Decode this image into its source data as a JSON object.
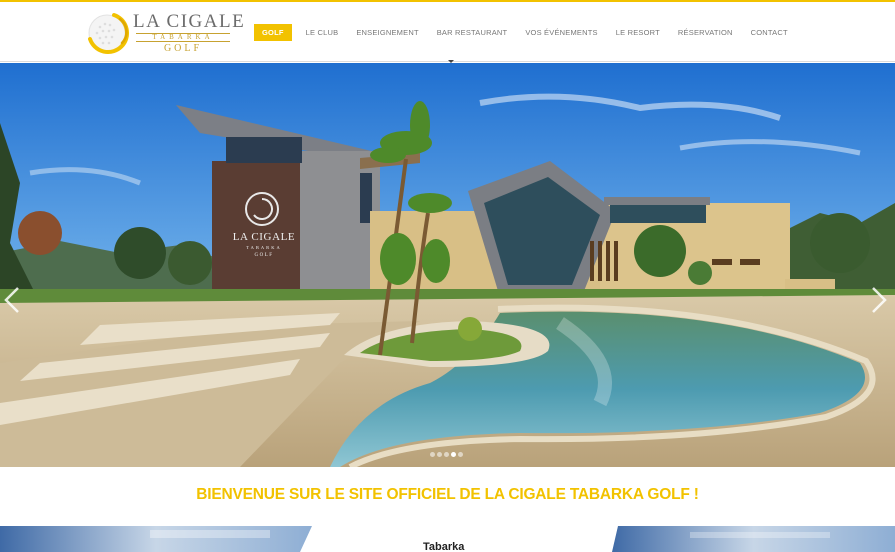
{
  "header": {
    "logo": {
      "name": "LA CIGALE",
      "sub": "TABARKA",
      "golf": "GOLF"
    },
    "nav": [
      {
        "label": "GOLF",
        "active": true
      },
      {
        "label": "LE CLUB"
      },
      {
        "label": "ENSEIGNEMENT"
      },
      {
        "label": "BAR RESTAURANT"
      },
      {
        "label": "VOS ÉVÉNEMENTS"
      },
      {
        "label": "LE RESORT"
      },
      {
        "label": "RÉSERVATION"
      },
      {
        "label": "CONTACT"
      }
    ]
  },
  "slider": {
    "building_sign": {
      "name": "LA CIGALE",
      "sub": "TABARKA",
      "golf": "GOLF"
    },
    "dots_count": 5,
    "active_dot": 4,
    "prev_icon": "chevron-left-icon",
    "next_icon": "chevron-right-icon"
  },
  "welcome": "BIENVENUE SUR LE SITE OFFICIEL DE LA CIGALE TABARKA GOLF !",
  "cards": {
    "center_title": "Tabarka"
  },
  "colors": {
    "accent": "#f2c200",
    "nav_text": "#777777",
    "logo_gold": "#c7a230"
  }
}
